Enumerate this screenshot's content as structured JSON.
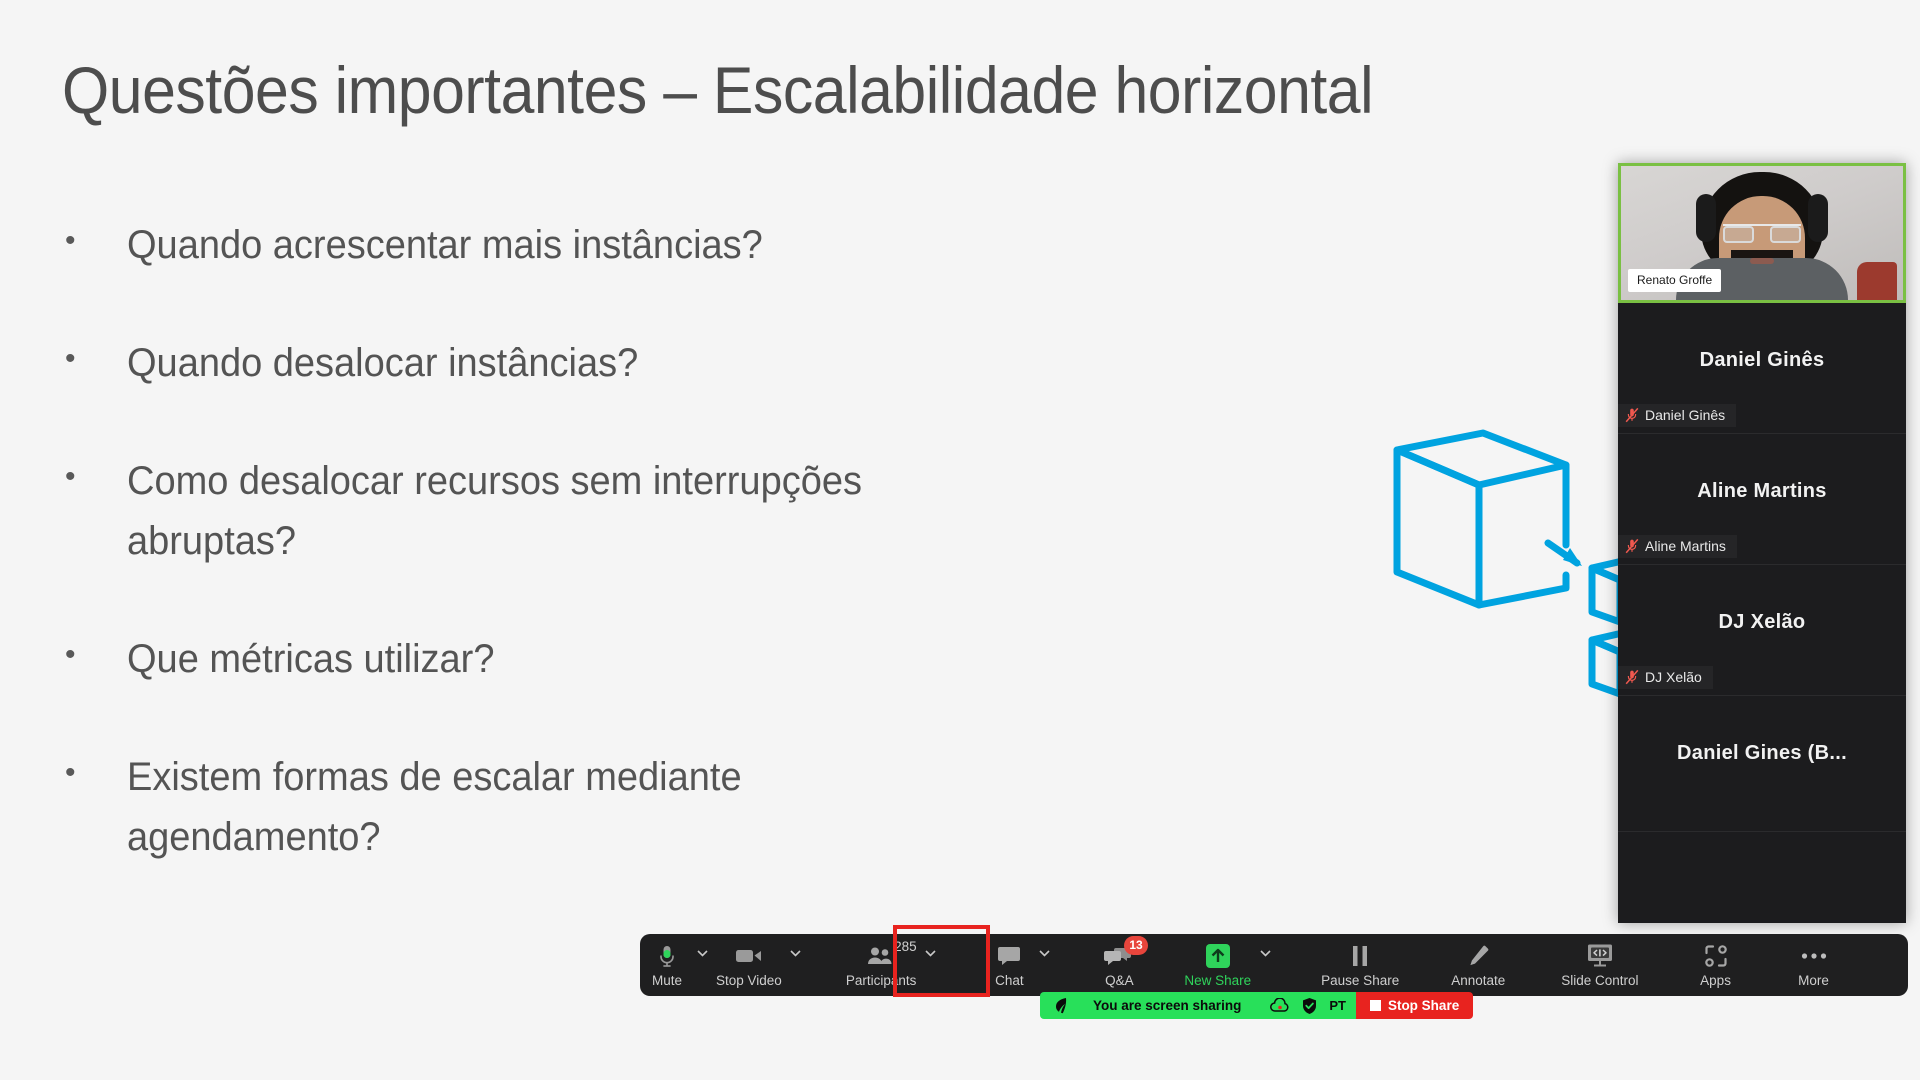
{
  "slide": {
    "title": "Questões importantes – Escalabilidade horizontal",
    "bullet_marker": "•",
    "bullets": [
      "Quando acrescentar mais instâncias?",
      "Quando desalocar instâncias?",
      "Como desalocar recursos sem interrupções abruptas?",
      "Que métricas utilizar?",
      "Existem formas de escalar mediante agendamento?"
    ],
    "graphic": {
      "name": "horizontal-scaling-cubes",
      "accent_color": "#00a3e0",
      "description": "Large wireframe cube with arrow pointing to smaller cubes"
    },
    "background_color": "#f5f5f5",
    "text_color": "#545454"
  },
  "participant_panel": {
    "self_video": {
      "name_label": "Renato Groffe",
      "active_border_color": "#7ac043"
    },
    "tiles": [
      {
        "center_name": "Daniel Ginês",
        "badge_name": "Daniel Ginês",
        "muted": true
      },
      {
        "center_name": "Aline Martins",
        "badge_name": "Aline Martins",
        "muted": true
      },
      {
        "center_name": "DJ Xelão",
        "badge_name": "DJ Xelão",
        "muted": true
      },
      {
        "center_name": "Daniel Gines (B...",
        "badge_name": "",
        "muted": false
      }
    ],
    "mute_icon_color": "#f0584f",
    "background_color": "#1c1c1e"
  },
  "toolbar": {
    "background_color": "#1f1f20",
    "items": [
      {
        "label": "Mute",
        "icon": "microphone-icon",
        "caret": true
      },
      {
        "label": "Stop Video",
        "icon": "video-camera-icon",
        "caret": true
      },
      {
        "label": "Participants",
        "icon": "participants-icon",
        "count": "285",
        "caret": true,
        "highlighted": true
      },
      {
        "label": "Chat",
        "icon": "chat-bubble-icon",
        "caret": true
      },
      {
        "label": "Q&A",
        "icon": "qa-bubbles-icon",
        "badge": "13"
      },
      {
        "label": "New Share",
        "icon": "share-up-arrow-icon",
        "caret": true,
        "green": true
      },
      {
        "label": "Pause Share",
        "icon": "pause-icon"
      },
      {
        "label": "Annotate",
        "icon": "pencil-icon"
      },
      {
        "label": "Slide Control",
        "icon": "slide-control-monitor-icon"
      },
      {
        "label": "Apps",
        "icon": "apps-icon"
      },
      {
        "label": "More",
        "icon": "more-dots-icon"
      }
    ],
    "highlight_color": "#e8231f"
  },
  "share_bar": {
    "status_text": "You are screen sharing",
    "language_label": "PT",
    "stop_label": "Stop Share",
    "green_color": "#28e05a",
    "stop_color": "#e8231f",
    "icons": [
      "leaf-icon",
      "cloud-record-icon",
      "shield-icon"
    ]
  }
}
